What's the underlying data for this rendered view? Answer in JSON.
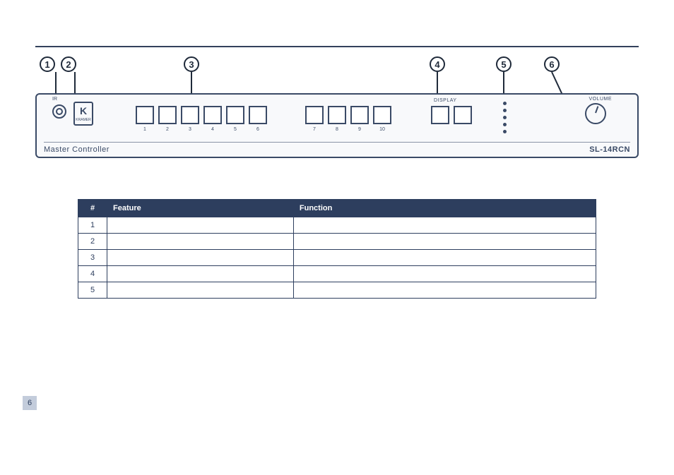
{
  "panel": {
    "title_left": "Master Controller",
    "title_right": "SL-14RCN",
    "ir_label": "IR",
    "display_label": "DISPLAY",
    "volume_label": "VOLUME",
    "logo_text": "K",
    "logo_sub": "KRAMER",
    "button_numbers_g1": [
      "1",
      "2",
      "3",
      "4",
      "5",
      "6"
    ],
    "button_numbers_g2": [
      "7",
      "8",
      "9",
      "10"
    ]
  },
  "callouts": [
    "1",
    "2",
    "3",
    "4",
    "5",
    "6"
  ],
  "table": {
    "headers": [
      "#",
      "Feature",
      "Function"
    ],
    "rows": [
      {
        "n": "1",
        "feature": "",
        "function": ""
      },
      {
        "n": "2",
        "feature": "",
        "function": ""
      },
      {
        "n": "3",
        "feature": "",
        "function": ""
      },
      {
        "n": "4",
        "feature": "",
        "function": ""
      },
      {
        "n": "5",
        "feature": "",
        "function": ""
      }
    ]
  },
  "page_number": "6"
}
